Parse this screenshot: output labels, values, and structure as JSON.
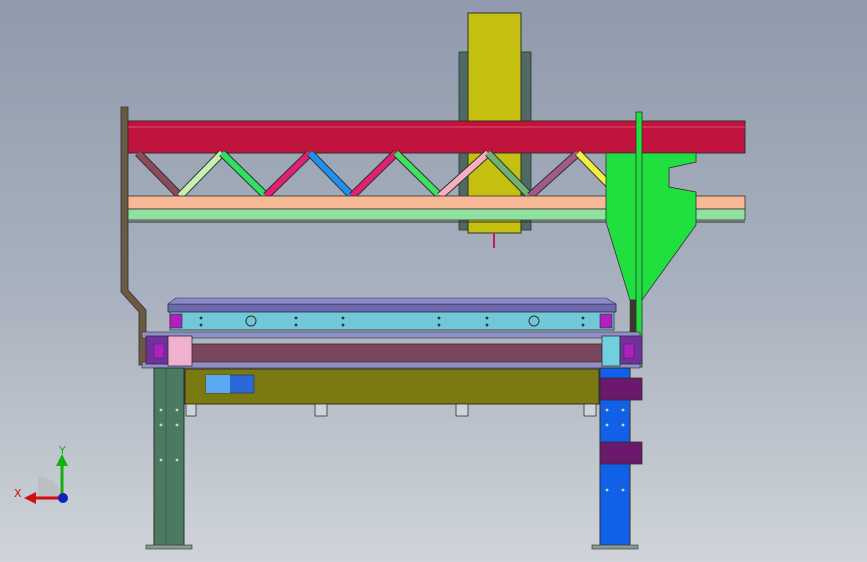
{
  "viewport": {
    "background_top": "#8f9aab",
    "background_bottom": "#cfd4da"
  },
  "triad": {
    "x_label": "X",
    "y_label": "Y",
    "x_color": "#d01010",
    "y_color": "#10b010",
    "z_color": "#1020c0"
  },
  "colors": {
    "column": "#c4c010",
    "top_beam": "#c0143c",
    "lower_chord_top": "#f8b898",
    "lower_chord_bottom": "#90e0a0",
    "left_post": "#6a5a40",
    "right_bracket": "#20e040",
    "slide_bar": "#70c8d8",
    "rail": "#7a4660",
    "tank": "#7a7a10",
    "left_leg": "#4a7a60",
    "right_leg": "#1060e8",
    "clamp": "#6a1a6a"
  },
  "truss_members": [
    "#8a4a5a",
    "#c8f0b0",
    "#30e060",
    "#e02070",
    "#2090f0",
    "#e02070",
    "#40e060",
    "#f8b0c0",
    "#70b070",
    "#a05a8a",
    "#f0f040"
  ]
}
